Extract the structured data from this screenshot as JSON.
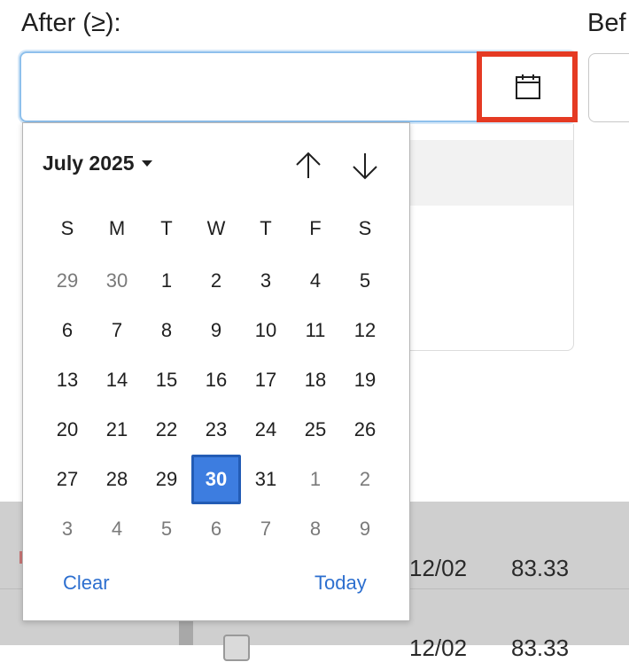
{
  "filters": {
    "after_label": "After (≥):",
    "after_value": "",
    "before_label_partial": "Bef"
  },
  "calendar": {
    "month_year": "July 2025",
    "weekdays": [
      "S",
      "M",
      "T",
      "W",
      "T",
      "F",
      "S"
    ],
    "weeks": [
      [
        {
          "d": "29",
          "other": true
        },
        {
          "d": "30",
          "other": true
        },
        {
          "d": "1"
        },
        {
          "d": "2"
        },
        {
          "d": "3"
        },
        {
          "d": "4"
        },
        {
          "d": "5"
        }
      ],
      [
        {
          "d": "6"
        },
        {
          "d": "7"
        },
        {
          "d": "8"
        },
        {
          "d": "9"
        },
        {
          "d": "10"
        },
        {
          "d": "11"
        },
        {
          "d": "12"
        }
      ],
      [
        {
          "d": "13"
        },
        {
          "d": "14"
        },
        {
          "d": "15"
        },
        {
          "d": "16"
        },
        {
          "d": "17"
        },
        {
          "d": "18"
        },
        {
          "d": "19"
        }
      ],
      [
        {
          "d": "20"
        },
        {
          "d": "21"
        },
        {
          "d": "22"
        },
        {
          "d": "23"
        },
        {
          "d": "24"
        },
        {
          "d": "25"
        },
        {
          "d": "26"
        }
      ],
      [
        {
          "d": "27"
        },
        {
          "d": "28"
        },
        {
          "d": "29"
        },
        {
          "d": "30",
          "selected": true
        },
        {
          "d": "31"
        },
        {
          "d": "1",
          "other": true
        },
        {
          "d": "2",
          "other": true
        }
      ],
      [
        {
          "d": "3",
          "other": true
        },
        {
          "d": "4",
          "other": true
        },
        {
          "d": "5",
          "other": true
        },
        {
          "d": "6",
          "other": true
        },
        {
          "d": "7",
          "other": true
        },
        {
          "d": "8",
          "other": true
        },
        {
          "d": "9",
          "other": true
        }
      ]
    ],
    "clear_label": "Clear",
    "today_label": "Today",
    "icons": {
      "prev": "arrow-up-icon",
      "next": "arrow-down-icon",
      "open": "calendar-icon"
    }
  },
  "background_table": {
    "row1": {
      "date": "12/02",
      "value": "83.33"
    },
    "row2": {
      "date": "12/02",
      "value": "83.33"
    }
  },
  "colors": {
    "accent": "#3d7de0",
    "highlight_box": "#e53a23",
    "link": "#2d6fcf"
  }
}
